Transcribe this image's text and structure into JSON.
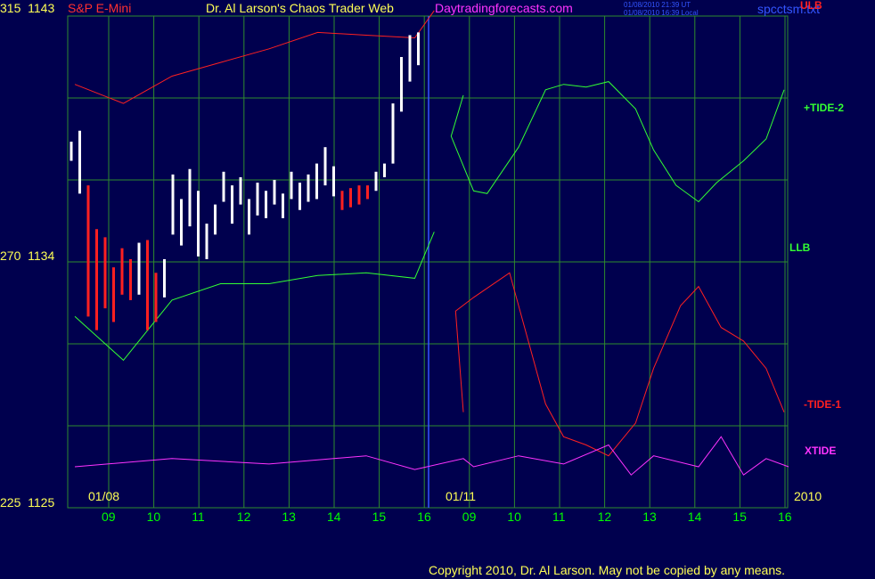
{
  "chart_data": {
    "type": "line",
    "instrument": "S&P E-Mini",
    "title": "Dr. Al Larson's Chaos Trader Web",
    "website": "Daytradingforecasts.com",
    "timestamp_ut": "01/08/2010 21:39 UT",
    "timestamp_local": "01/08/2010 16:39 Local",
    "file": "spcctsm.txt",
    "left_scale": [
      {
        "wave": "315",
        "price": "1143"
      },
      {
        "wave": "270",
        "price": "1134"
      },
      {
        "wave": "225",
        "price": "1125"
      }
    ],
    "ylim": [
      1125,
      1143
    ],
    "line_labels": {
      "ulb": "ULB",
      "tide2": "+TIDE-2",
      "llb": "LLB",
      "tide1": "-TIDE-1",
      "xtide": "XTIDE"
    },
    "dates": [
      "01/08",
      "01/11"
    ],
    "year": "2010",
    "x_ticks": [
      "09",
      "10",
      "11",
      "12",
      "13",
      "14",
      "15",
      "16",
      "09",
      "10",
      "11",
      "12",
      "13",
      "14",
      "15",
      "16"
    ],
    "copyright": "Copyright 2010, Dr. Al Larson. May not be copied by any means.",
    "colors": {
      "background": "#00004e",
      "grid": "#2e8b2e",
      "price_up": "#ffffff",
      "price_down": "#ff2020",
      "ulb": "#ff2020",
      "tide2": "#33ff33",
      "tide1": "#ff2020",
      "xtide": "#ff33ff",
      "separator": "#3355ff"
    },
    "series": [
      {
        "name": "ULB",
        "x": [
          0,
          1,
          2,
          3,
          4,
          5,
          6,
          7,
          7.4
        ],
        "values": [
          1140.5,
          1139.8,
          1140.8,
          1141.3,
          1141.8,
          1142.4,
          1142.3,
          1142.2,
          1143.2
        ]
      },
      {
        "name": "+TIDE-2",
        "x": [
          8,
          8.5,
          9,
          9.3,
          10,
          10.6,
          11,
          11.5,
          12,
          12.6,
          13,
          13.5,
          14,
          14.4,
          15,
          15.5,
          15.9
        ],
        "values": [
          1140.1,
          1138.6,
          1136.6,
          1136.5,
          1138.2,
          1140.3,
          1140.5,
          1140.4,
          1140.6,
          1139.6,
          1138.1,
          1136.8,
          1136.2,
          1136.9,
          1137.7,
          1138.5,
          1140.3
        ]
      },
      {
        "name": "LLB",
        "x": [
          0,
          1,
          2,
          3,
          4,
          5,
          6,
          7,
          7.4
        ],
        "values": [
          1132,
          1130.4,
          1132.6,
          1133.2,
          1133.2,
          1133.5,
          1133.6,
          1133.4,
          1135.1
        ]
      },
      {
        "name": "-TIDE-1",
        "x": [
          8,
          8.6,
          9,
          9.8,
          10.6,
          11,
          11.5,
          12,
          12.6,
          13,
          13.6,
          14,
          14.5,
          15,
          15.5,
          15.9
        ],
        "values": [
          1128.5,
          1132.2,
          1132.7,
          1133.6,
          1128.8,
          1127.6,
          1127.3,
          1126.9,
          1128.1,
          1130.1,
          1132.4,
          1133.1,
          1131.6,
          1131.1,
          1130.1,
          1128.5
        ]
      },
      {
        "name": "XTIDE",
        "x": [
          0,
          2,
          4,
          6,
          7,
          8,
          9,
          10,
          11,
          12,
          12.5,
          13,
          14,
          14.5,
          15,
          15.5,
          16
        ],
        "values": [
          1126.5,
          1126.8,
          1126.6,
          1126.9,
          1126.4,
          1126.8,
          1126.5,
          1126.9,
          1126.6,
          1127.3,
          1126.2,
          1126.9,
          1126.5,
          1127.6,
          1126.2,
          1126.8,
          1126.5
        ]
      }
    ]
  }
}
